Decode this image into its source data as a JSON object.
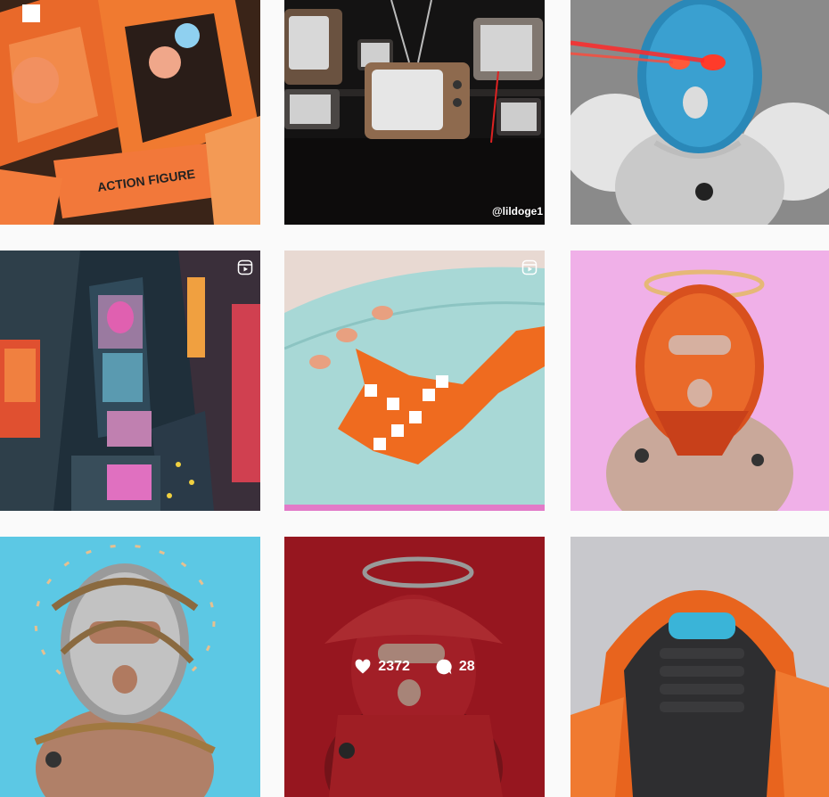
{
  "posts": [
    {
      "id": "box-toys",
      "caption": ""
    },
    {
      "id": "tv-wall",
      "watermark": "@lildoge1"
    },
    {
      "id": "blue-mask-laser"
    },
    {
      "id": "times-square",
      "is_reel": true
    },
    {
      "id": "sneaker-closeup",
      "is_reel": true
    },
    {
      "id": "orange-mask-halo"
    },
    {
      "id": "gray-mask-thorns"
    },
    {
      "id": "red-bucket-hat",
      "hovered": true,
      "likes": "2372",
      "comments": "28"
    },
    {
      "id": "orange-hoodie"
    }
  ],
  "icons": {
    "like": "heart-icon",
    "comment": "comment-icon",
    "reel": "reel-icon"
  },
  "colors": {
    "background": "#fafafa",
    "overlay_text": "#ffffff"
  }
}
